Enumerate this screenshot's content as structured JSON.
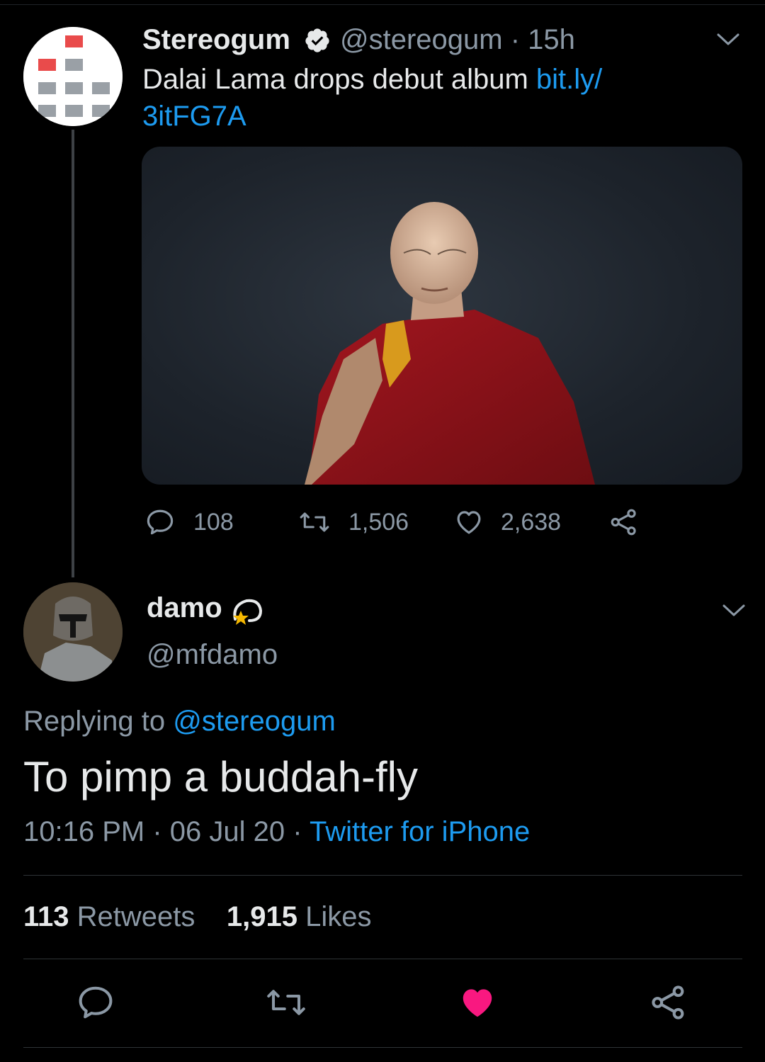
{
  "parent_tweet": {
    "author_name": "Stereogum",
    "handle": "@stereogum",
    "time_ago": "15h",
    "meta_separator": "·",
    "text": "Dalai Lama drops debut album ",
    "link_line1": "bit.ly/",
    "link_line2": "3itFG7A",
    "replies": "108",
    "retweets": "1,506",
    "likes": "2,638"
  },
  "reply_tweet": {
    "author_name": "damo",
    "handle": "@mfdamo",
    "replying_to_label": "Replying to ",
    "replying_to_handle": "@stereogum",
    "text": "To pimp a buddah-fly",
    "time": "10:16 PM",
    "date": "06 Jul 20",
    "dot": "·",
    "source": "Twitter for iPhone",
    "retweet_count": "113",
    "retweet_label": "Retweets",
    "like_count": "1,915",
    "like_label": "Likes"
  },
  "icons": {
    "reply": "reply-icon",
    "retweet": "retweet-icon",
    "like": "heart-icon",
    "share": "share-icon",
    "verified": "verified-badge-icon",
    "menu": "chevron-down-icon",
    "emoji": "dizzy-star-emoji-icon"
  },
  "colors": {
    "background": "#000000",
    "link": "#1d9bf0",
    "secondary_text": "#8b98a5",
    "like_active": "#f91880"
  }
}
